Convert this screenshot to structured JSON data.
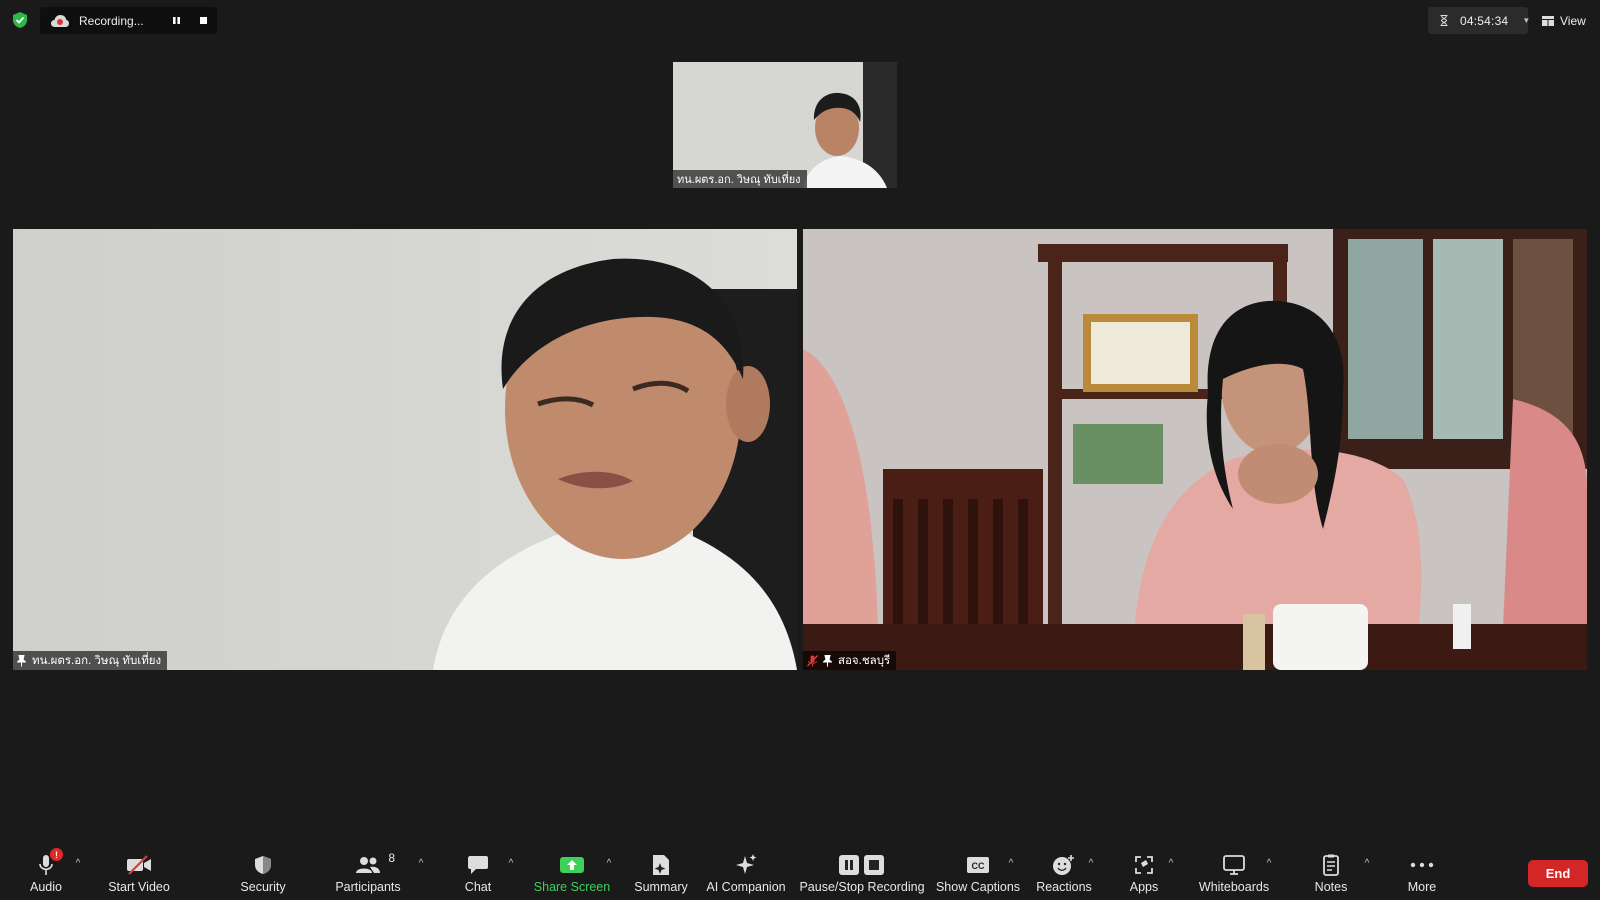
{
  "topbar": {
    "recording_label": "Recording...",
    "timer": "04:54:34",
    "view_label": "View"
  },
  "participants_video": {
    "thumbnail_name": "ทน.ผตร.อก. วิษณุ ทับเที่ยง",
    "left_name": "ทน.ผตร.อก. วิษณุ ทับเที่ยง",
    "right_name": "สอจ.ชลบุรี"
  },
  "toolbar": {
    "audio": "Audio",
    "audio_badge": "!",
    "start_video": "Start Video",
    "security": "Security",
    "participants": "Participants",
    "participants_count": "8",
    "chat": "Chat",
    "share_screen": "Share Screen",
    "summary": "Summary",
    "ai_companion": "AI Companion",
    "pause_stop_recording": "Pause/Stop Recording",
    "show_captions": "Show Captions",
    "captions_glyph": "CC",
    "reactions": "Reactions",
    "apps": "Apps",
    "whiteboards": "Whiteboards",
    "notes": "Notes",
    "more": "More",
    "end": "End"
  },
  "colors": {
    "background": "#1a1a1a",
    "share_green": "#3fd05a",
    "end_red": "#d32626",
    "security_shield": "#2fb84a"
  }
}
